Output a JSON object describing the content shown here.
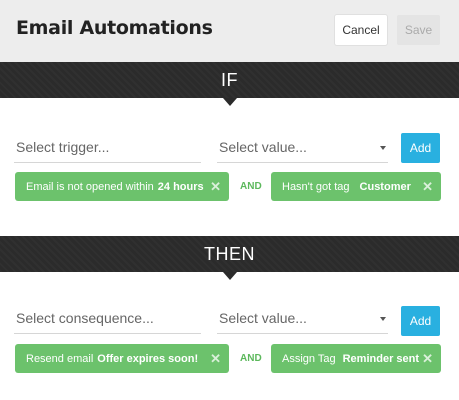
{
  "header": {
    "title": "Email Automations",
    "cancel_label": "Cancel",
    "save_label": "Save"
  },
  "if_section": {
    "label": "IF",
    "trigger_placeholder": "Select trigger...",
    "value_placeholder": "Select value...",
    "add_label": "Add",
    "conditions": [
      {
        "text": "Email is not opened within",
        "bold": "24 hours"
      },
      {
        "text": "Hasn't got tag",
        "bold": "Customer"
      }
    ],
    "connector": "AND"
  },
  "then_section": {
    "label": "THEN",
    "consequence_placeholder": "Select consequence...",
    "value_placeholder": "Select value...",
    "add_label": "Add",
    "actions": [
      {
        "text": "Resend email",
        "bold": "Offer expires soon!"
      },
      {
        "text": "Assign Tag",
        "bold": "Reminder sent"
      }
    ],
    "connector": "AND"
  },
  "icons": {
    "remove": "close-icon",
    "dropdown": "caret-down-icon"
  },
  "colors": {
    "accent": "#29b0e0",
    "chip": "#6cc26c",
    "band": "#2b2b2b",
    "header": "#ededed"
  }
}
